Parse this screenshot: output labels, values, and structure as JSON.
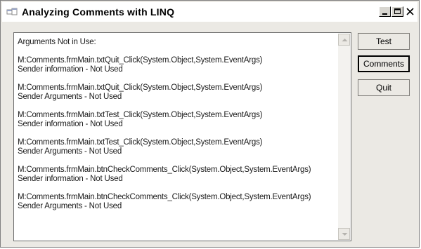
{
  "window": {
    "title": "Analyzing Comments with LINQ",
    "controls": {
      "minimize": "_",
      "close": "X"
    }
  },
  "output_list": {
    "lines": [
      "Arguments Not in Use:",
      "",
      "M:Comments.frmMain.txtQuit_Click(System.Object,System.EventArgs)",
      "Sender information - Not Used",
      "",
      "M:Comments.frmMain.txtQuit_Click(System.Object,System.EventArgs)",
      "Sender Arguments - Not Used",
      "",
      "M:Comments.frmMain.txtTest_Click(System.Object,System.EventArgs)",
      "Sender information - Not Used",
      "",
      "M:Comments.frmMain.txtTest_Click(System.Object,System.EventArgs)",
      "Sender Arguments - Not Used",
      "",
      "M:Comments.frmMain.btnCheckComments_Click(System.Object,System.EventArgs)",
      "Sender information - Not Used",
      "",
      "M:Comments.frmMain.btnCheckComments_Click(System.Object,System.EventArgs)",
      "Sender Arguments - Not Used"
    ]
  },
  "buttons": {
    "test": "Test",
    "comments": "Comments",
    "quit": "Quit"
  }
}
